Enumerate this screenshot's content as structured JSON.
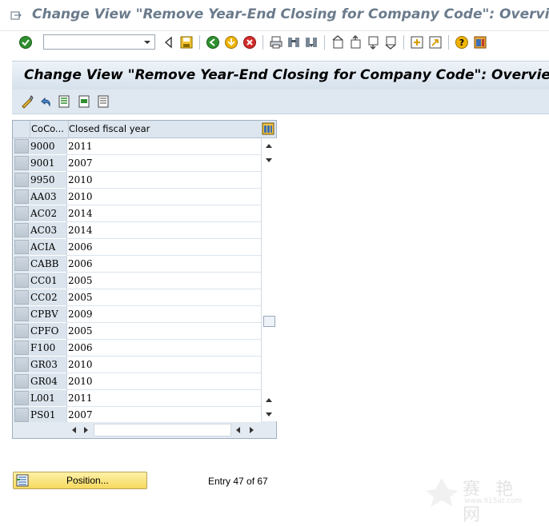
{
  "window": {
    "title": "Change View \"Remove Year-End Closing for Company Code\": Overview"
  },
  "std_toolbar": {
    "command_field_value": ""
  },
  "header": {
    "title": "Change View \"Remove Year-End Closing for Company Code\": Overview"
  },
  "table": {
    "columns": [
      "CoCo...",
      "Closed fiscal year"
    ],
    "rows": [
      {
        "coco": "9000",
        "year": "2011"
      },
      {
        "coco": "9001",
        "year": "2007"
      },
      {
        "coco": "9950",
        "year": "2010"
      },
      {
        "coco": "AA03",
        "year": "2010"
      },
      {
        "coco": "AC02",
        "year": "2014"
      },
      {
        "coco": "AC03",
        "year": "2014"
      },
      {
        "coco": "ACIA",
        "year": "2006"
      },
      {
        "coco": "CABB",
        "year": "2006"
      },
      {
        "coco": "CC01",
        "year": "2005"
      },
      {
        "coco": "CC02",
        "year": "2005"
      },
      {
        "coco": "CPBV",
        "year": "2009"
      },
      {
        "coco": "CPFO",
        "year": "2005"
      },
      {
        "coco": "F100",
        "year": "2006"
      },
      {
        "coco": "GR03",
        "year": "2010"
      },
      {
        "coco": "GR04",
        "year": "2010"
      },
      {
        "coco": "L001",
        "year": "2011"
      },
      {
        "coco": "PS01",
        "year": "2007"
      }
    ]
  },
  "footer": {
    "position_button_label": "Position...",
    "entry_text": "Entry 47 of 67"
  },
  "watermark": {
    "text": "赛 艳 网",
    "url": "www.915at.com"
  },
  "colors": {
    "header_bg": "#d6e1ec",
    "position_button": "#f6d95e"
  }
}
